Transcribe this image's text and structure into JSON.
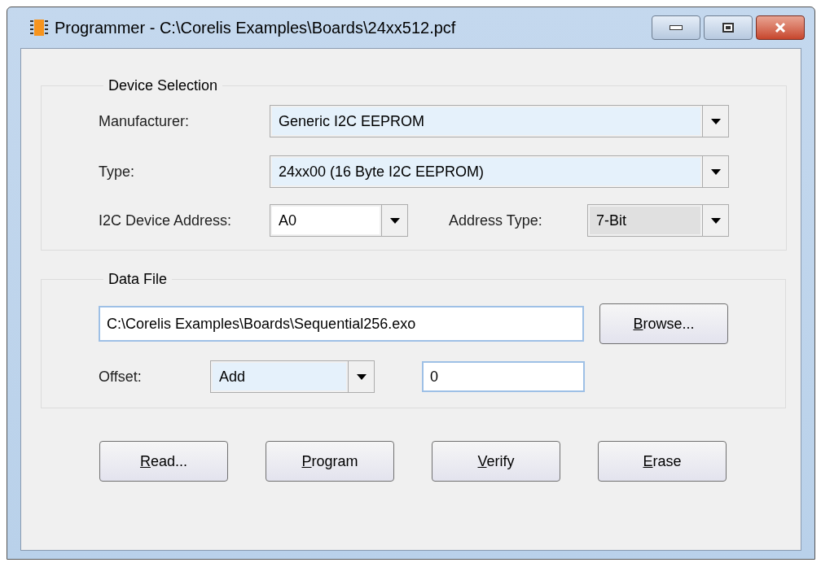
{
  "window": {
    "title": "Programmer - C:\\Corelis Examples\\Boards\\24xx512.pcf"
  },
  "device_selection": {
    "title": "Device Selection",
    "manufacturer": {
      "label": "Manufacturer:",
      "value": "Generic I2C EEPROM",
      "kind": "list"
    },
    "type": {
      "label": "Type:",
      "value": "24xx00 (16 Byte I2C EEPROM)",
      "kind": "list"
    },
    "device_address": {
      "label": "I2C Device Address:",
      "value": "A0",
      "kind": "editable"
    },
    "address_type": {
      "label": "Address Type:",
      "value": "7-Bit",
      "kind": "readonly"
    }
  },
  "data_file": {
    "title": "Data File",
    "path": "C:\\Corelis Examples\\Boards\\Sequential256.exo",
    "browse": {
      "label": "Browse...",
      "underline_first": true
    },
    "offset_label": "Offset:",
    "offset_mode": {
      "value": "Add",
      "kind": "list"
    },
    "offset_value": "0"
  },
  "buttons": [
    {
      "label": "Read...",
      "underline_first": true
    },
    {
      "label": "Program",
      "underline_first": true
    },
    {
      "label": "Verify",
      "underline_first": true
    },
    {
      "label": "Erase",
      "underline_first": true
    }
  ]
}
